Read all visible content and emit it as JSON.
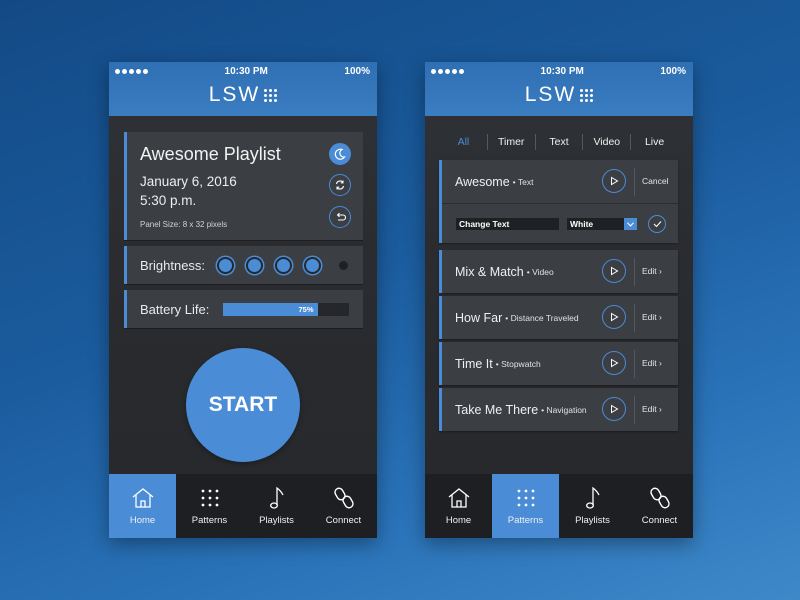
{
  "status": {
    "time": "10:30 PM",
    "battery": "100%"
  },
  "brand": {
    "logo": "LSW"
  },
  "colors": {
    "accent": "#4a8cd6",
    "header": "#3b7dc1",
    "panel": "#3b3e43",
    "tabbar": "#1d1f22"
  },
  "home": {
    "playlist": {
      "title": "Awesome Playlist",
      "date": "January 6, 2016",
      "time": "5:30 p.m.",
      "panel_size": "Panel Size: 8 x 32 pixels",
      "icons": [
        "moon-icon",
        "sync-icon",
        "undo-icon"
      ]
    },
    "brightness": {
      "label": "Brightness:",
      "level": 4,
      "max": 5
    },
    "battery": {
      "label": "Battery Life:",
      "percent": 75,
      "percent_label": "75%"
    },
    "start_label": "START"
  },
  "patterns": {
    "filters": [
      {
        "label": "All",
        "active": true
      },
      {
        "label": "Timer",
        "active": false
      },
      {
        "label": "Text",
        "active": false
      },
      {
        "label": "Video",
        "active": false
      },
      {
        "label": "Live",
        "active": false
      }
    ],
    "items": [
      {
        "name": "Awesome",
        "type": "• Text",
        "action": "Cancel"
      },
      {
        "name": "Mix & Match",
        "type": "• Video",
        "action": "Edit ›"
      },
      {
        "name": "How Far",
        "type": "• Distance Traveled",
        "action": "Edit ›"
      },
      {
        "name": "Time It",
        "type": "• Stopwatch",
        "action": "Edit ›"
      },
      {
        "name": "Take Me There",
        "type": "• Navigation",
        "action": "Edit ›"
      }
    ],
    "editor": {
      "text_value": "Change Text",
      "color_value": "White"
    }
  },
  "tabs": [
    {
      "label": "Home",
      "icon": "home-icon"
    },
    {
      "label": "Patterns",
      "icon": "grid-icon"
    },
    {
      "label": "Playlists",
      "icon": "music-note-icon"
    },
    {
      "label": "Connect",
      "icon": "link-icon"
    }
  ],
  "active_tab": {
    "left": "Home",
    "right": "Patterns"
  }
}
